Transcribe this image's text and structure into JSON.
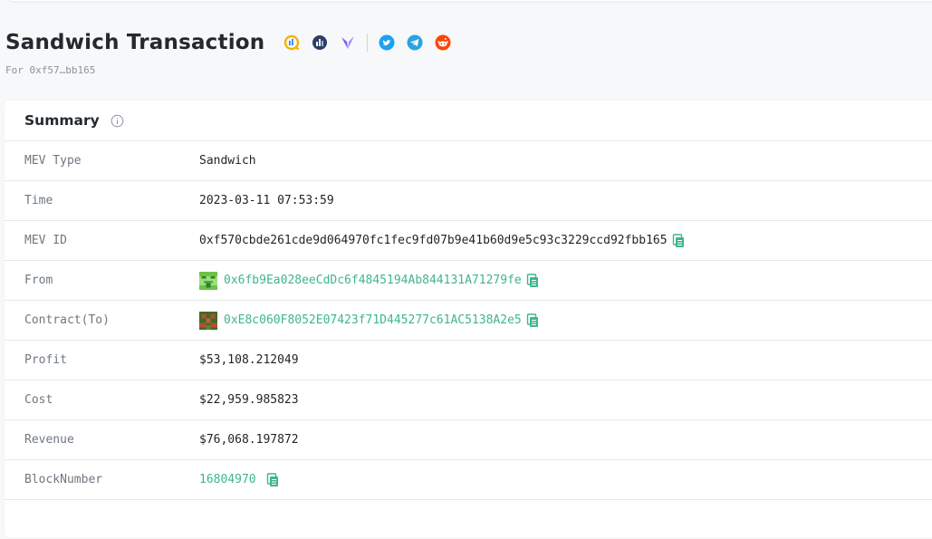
{
  "page": {
    "title": "Sandwich Transaction",
    "subtitle": "For 0xf57…bb165"
  },
  "social_icons": [
    "analytics-q-icon",
    "chart-icon",
    "arrow-y-icon",
    "twitter-icon",
    "telegram-icon",
    "reddit-icon"
  ],
  "summary": {
    "title": "Summary",
    "rows": {
      "mev_type": {
        "label": "MEV Type",
        "value": "Sandwich"
      },
      "time": {
        "label": "Time",
        "value": "2023-03-11 07:53:59"
      },
      "mev_id": {
        "label": "MEV ID",
        "value": "0xf570cbde261cde9d064970fc1fec9fd07b9e41b60d9e5c93c3229ccd92fbb165"
      },
      "from": {
        "label": "From",
        "value": "0x6fb9Ea028eeCdDc6f4845194Ab844131A71279fe"
      },
      "contract": {
        "label": "Contract(To)",
        "value": "0xE8c060F8052E07423f71D445277c61AC5138A2e5"
      },
      "profit": {
        "label": "Profit",
        "value": "$53,108.212049"
      },
      "cost": {
        "label": "Cost",
        "value": "$22,959.985823"
      },
      "revenue": {
        "label": "Revenue",
        "value": "$76,068.197872"
      },
      "block_number": {
        "label": "BlockNumber",
        "value": "16804970"
      }
    }
  },
  "colors": {
    "link": "#3fb68b",
    "label": "#6e7781",
    "background": "#f6f8fa"
  }
}
